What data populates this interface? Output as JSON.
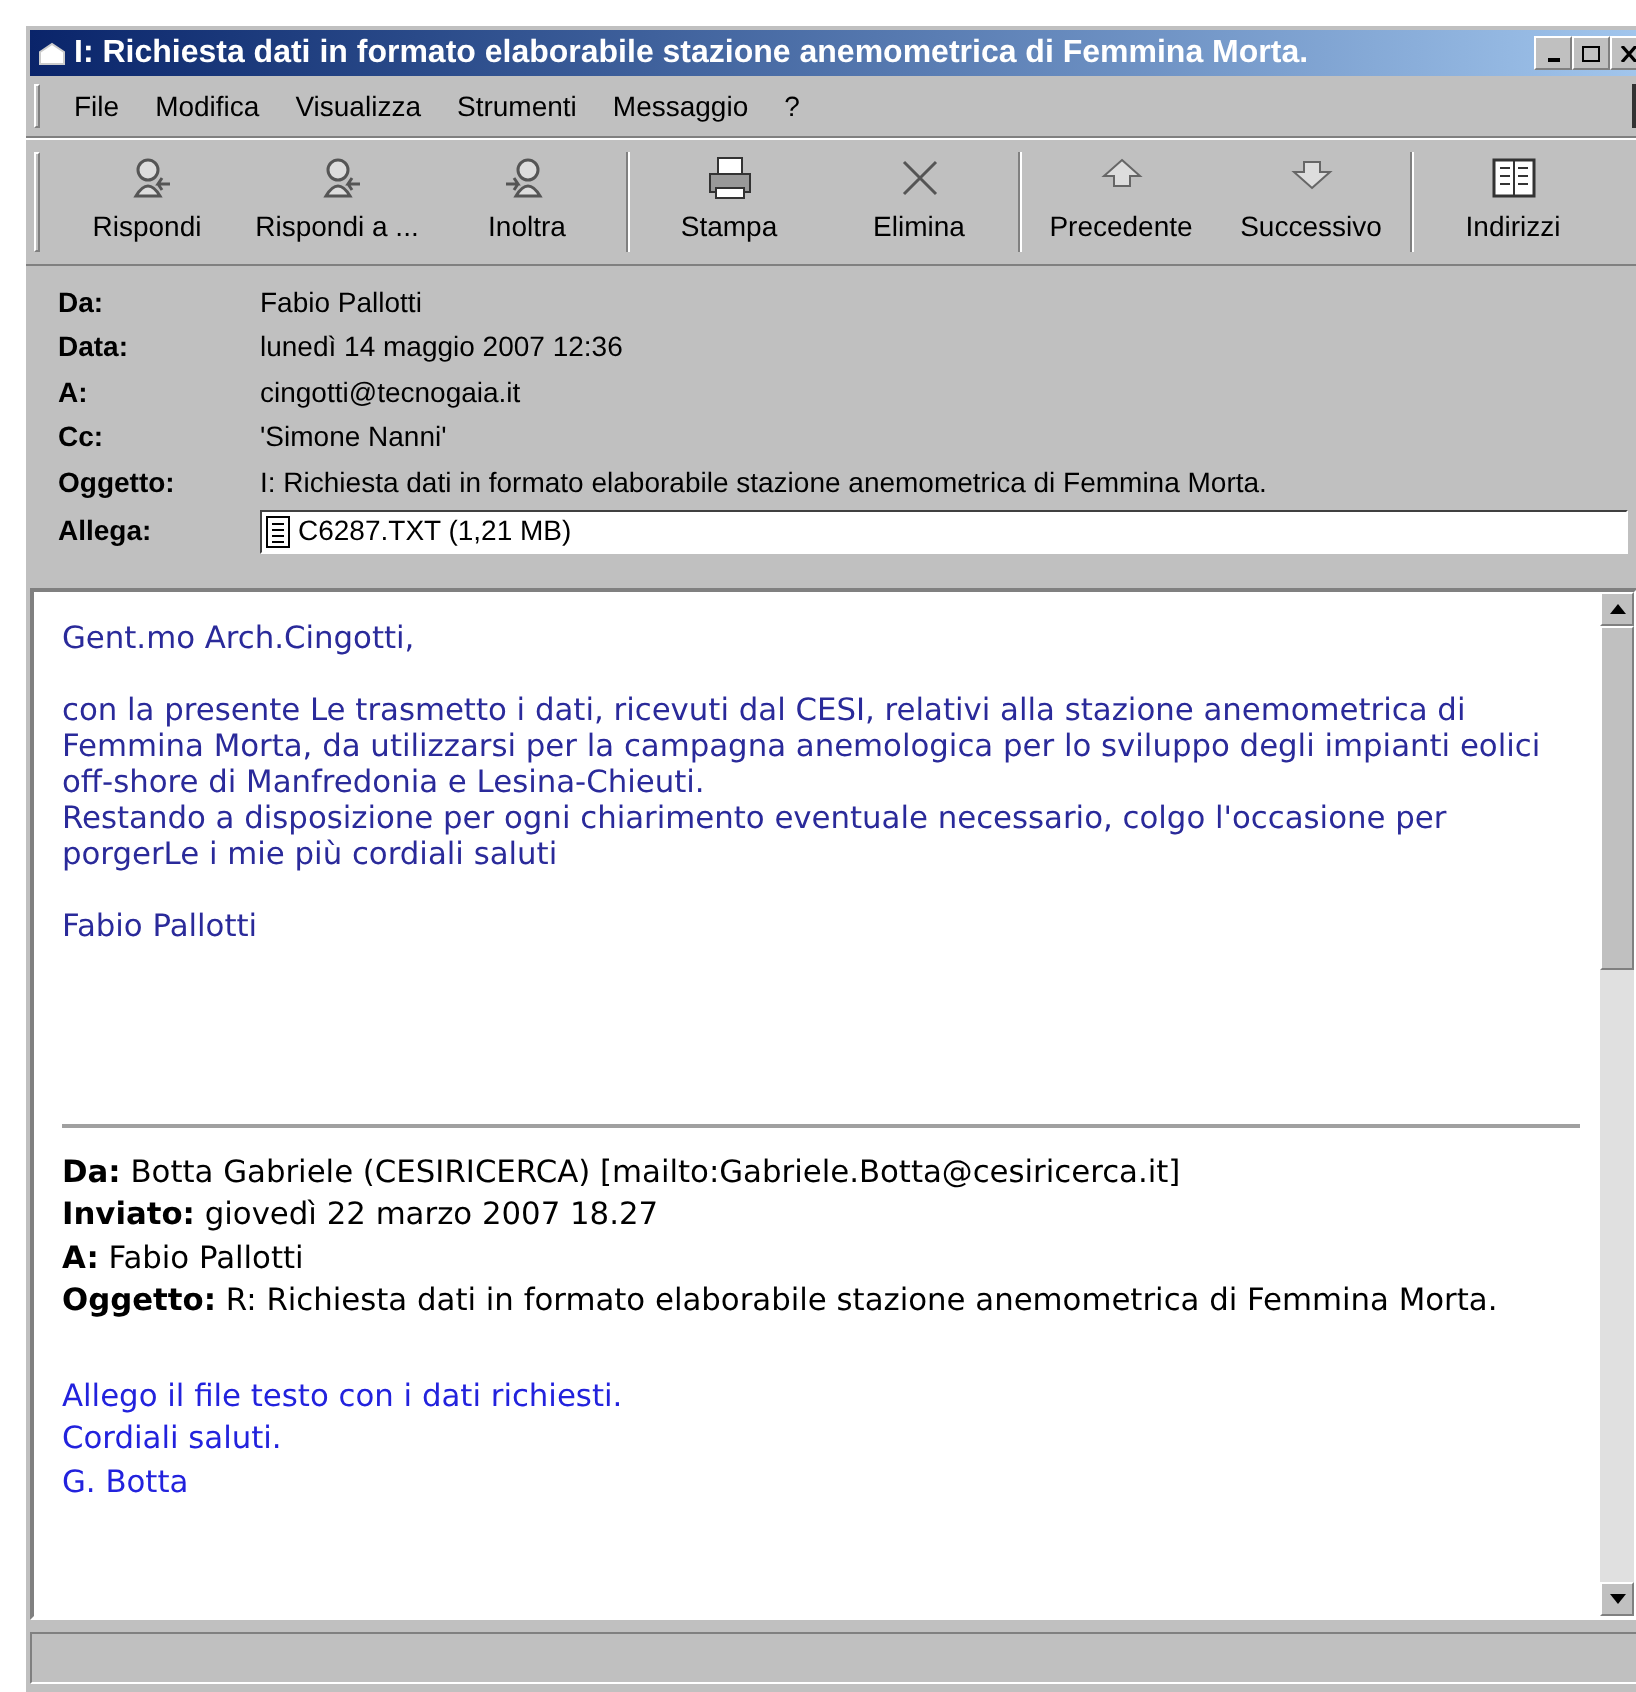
{
  "window": {
    "title": "I: Richiesta dati in formato elaborabile stazione anemometrica di Femmina Morta."
  },
  "menu": [
    "File",
    "Modifica",
    "Visualizza",
    "Strumenti",
    "Messaggio",
    "?"
  ],
  "toolbar": [
    [
      {
        "label": "Rispondi",
        "kind": "reply"
      },
      {
        "label": "Rispondi a ...",
        "kind": "reply-all"
      },
      {
        "label": "Inoltra",
        "kind": "forward"
      }
    ],
    [
      {
        "label": "Stampa",
        "kind": "print"
      },
      {
        "label": "Elimina",
        "kind": "delete"
      }
    ],
    [
      {
        "label": "Precedente",
        "kind": "up"
      },
      {
        "label": "Successivo",
        "kind": "down"
      }
    ],
    [
      {
        "label": "Indirizzi",
        "kind": "book"
      }
    ]
  ],
  "header": [
    {
      "label": "Da:",
      "value": "Fabio Pallotti"
    },
    {
      "label": "Data:",
      "value": "lunedì 14 maggio 2007 12:36"
    },
    {
      "label": "A:",
      "value": "cingotti@tecnogaia.it"
    },
    {
      "label": "Cc:",
      "value": "'Simone Nanni'"
    },
    {
      "label": "Oggetto:",
      "value": "I: Richiesta dati in formato elaborabile stazione anemometrica di Femmina Morta."
    }
  ],
  "attachment": {
    "label": "Allega:",
    "file": "C6287.TXT (1,21 MB)"
  },
  "body": [
    "Gent.mo Arch.Cingotti,",
    "con la presente Le trasmetto i dati, ricevuti dal CESI, relativi alla stazione anemometrica di\nFemmina Morta, da utilizzarsi per la campagna anemologica per lo sviluppo degli impianti eolici\noff-shore di Manfredonia e Lesina-Chieuti.\nRestando a disposizione per ogni chiarimento eventuale necessario, colgo l'occasione per\nporgerLe i mie più cordiali saluti",
    "Fabio Pallotti"
  ],
  "quoted_header": [
    "**Da:** Botta Gabriele (CESIRICERCA) [mailto:Gabriele.Botta@cesiricerca.it]",
    "**Inviato:** giovedì 22 marzo 2007 18.27",
    "**A:** Fabio Pallotti",
    "**Oggetto:** R: Richiesta dati in formato elaborabile stazione anemometrica di Femmina Morta."
  ],
  "quoted_body": [
    "Allego il file testo con i dati richiesti.",
    "Cordiali saluti.",
    "G. Botta"
  ]
}
